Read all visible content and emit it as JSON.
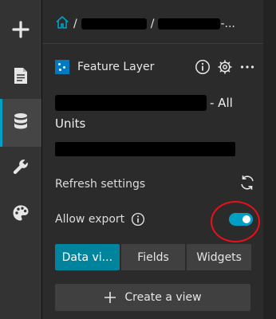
{
  "rail": {
    "items": [
      {
        "icon": "plus-icon"
      },
      {
        "icon": "document-icon"
      },
      {
        "icon": "database-icon"
      },
      {
        "icon": "wrench-icon"
      },
      {
        "icon": "palette-icon"
      }
    ],
    "active_index": 2
  },
  "breadcrumb": {
    "home_icon": "home-icon",
    "separator": "/",
    "truncated_suffix": "-..."
  },
  "layer": {
    "title": "Feature Layer",
    "icon_color": "#0079c1",
    "actions": [
      "info-icon",
      "gear-icon",
      "more-icon"
    ]
  },
  "item": {
    "title_visible_suffix": "- All",
    "title_line2": "Units"
  },
  "settings": {
    "refresh_label": "Refresh settings",
    "refresh_icon": "refresh-icon",
    "export_label": "Allow export",
    "export_info_icon": "info-icon",
    "export_enabled": true
  },
  "tabs": [
    {
      "label": "Data vi...",
      "active": true
    },
    {
      "label": "Fields",
      "active": false
    },
    {
      "label": "Widgets",
      "active": false
    }
  ],
  "create_view": {
    "label": "Create a view",
    "icon": "plus-icon"
  },
  "colors": {
    "accent": "#00a0c6",
    "active_tab": "#00839c",
    "annotation_ring": "#e8101a",
    "panel_bg": "#2b2b2b",
    "rail_bg": "#333333"
  }
}
